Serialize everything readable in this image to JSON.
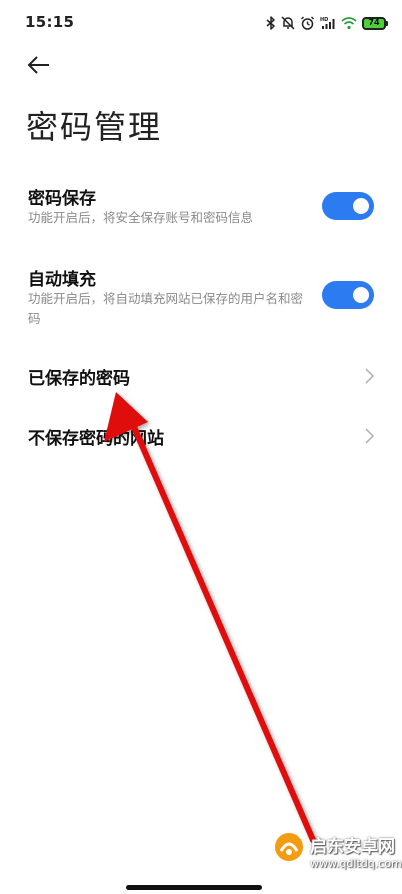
{
  "status_bar": {
    "time": "15:15",
    "icons": [
      "bluetooth-icon",
      "mute-bell-icon",
      "alarm-icon",
      "hd-signal-icon",
      "wifi-icon"
    ],
    "battery_level": "74"
  },
  "header": {
    "back_icon": "back-arrow-icon",
    "title": "密码管理"
  },
  "settings": [
    {
      "title": "密码保存",
      "description": "功能开启后，将安全保存账号和密码信息",
      "toggle_on": true
    },
    {
      "title": "自动填充",
      "description": "功能开启后，将自动填充网站已保存的用户名和密码",
      "toggle_on": true
    }
  ],
  "nav_items": [
    {
      "label": "已保存的密码",
      "icon": "chevron-right-icon"
    },
    {
      "label": "不保存密码的网站",
      "icon": "chevron-right-icon"
    }
  ],
  "colors": {
    "accent": "#2c7bf0",
    "annotation": "#e01010"
  },
  "watermark": {
    "title": "启东安卓网",
    "url": "www.qdltdq.com"
  }
}
